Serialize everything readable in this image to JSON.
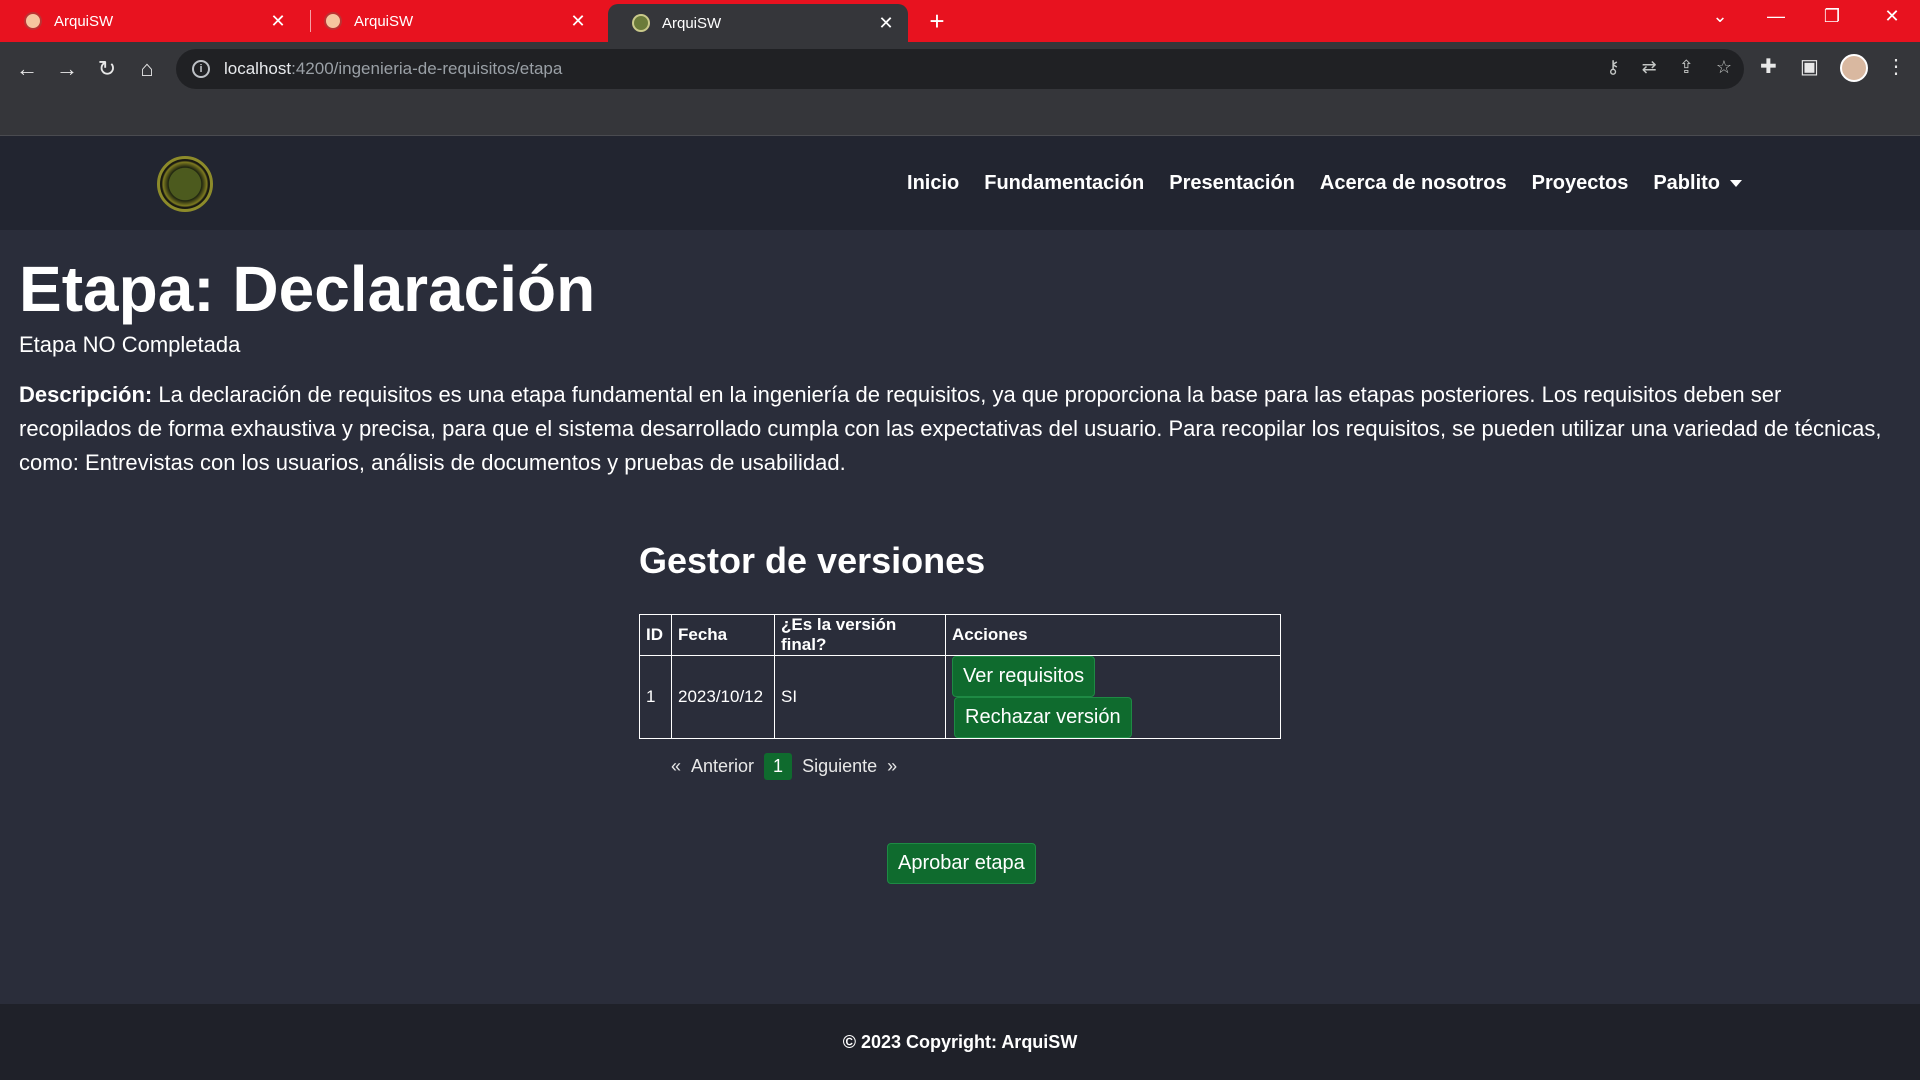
{
  "browser": {
    "tabs": [
      {
        "title": "ArquiSW"
      },
      {
        "title": "ArquiSW"
      },
      {
        "title": "ArquiSW"
      }
    ],
    "url_host": "localhost",
    "url_path": ":4200/ingenieria-de-requisitos/etapa"
  },
  "colors": {
    "browser_accent": "#e8121f",
    "button_green": "#0f6b2e",
    "page_bg": "#2a2d3a"
  },
  "nav": {
    "links": [
      "Inicio",
      "Fundamentación",
      "Presentación",
      "Acerca de nosotros",
      "Proyectos"
    ],
    "user": "Pablito"
  },
  "page": {
    "title": "Etapa: Declaración",
    "status": "Etapa NO Completada",
    "desc_label": "Descripción:",
    "desc_text": " La declaración de requisitos es una etapa fundamental en la ingeniería de requisitos, ya que proporciona la base para las etapas posteriores. Los requisitos deben ser recopilados de forma exhaustiva y precisa, para que el sistema desarrollado cumpla con las expectativas del usuario. Para recopilar los requisitos, se pueden utilizar una variedad de técnicas, como: Entrevistas con los usuarios, análisis de documentos y pruebas de usabilidad."
  },
  "versions": {
    "title": "Gestor de versiones",
    "headers": [
      "ID",
      "Fecha",
      "¿Es la versión final?",
      "Acciones"
    ],
    "rows": [
      {
        "id": "1",
        "fecha": "2023/10/12",
        "final": "SI",
        "view_label": "Ver requisitos",
        "reject_label": "Rechazar versión"
      }
    ],
    "pager": {
      "first": "«",
      "prev": "Anterior",
      "current": "1",
      "next": "Siguiente",
      "last": "»"
    }
  },
  "approve_label": "Aprobar etapa",
  "footer": "© 2023 Copyright: ArquiSW"
}
